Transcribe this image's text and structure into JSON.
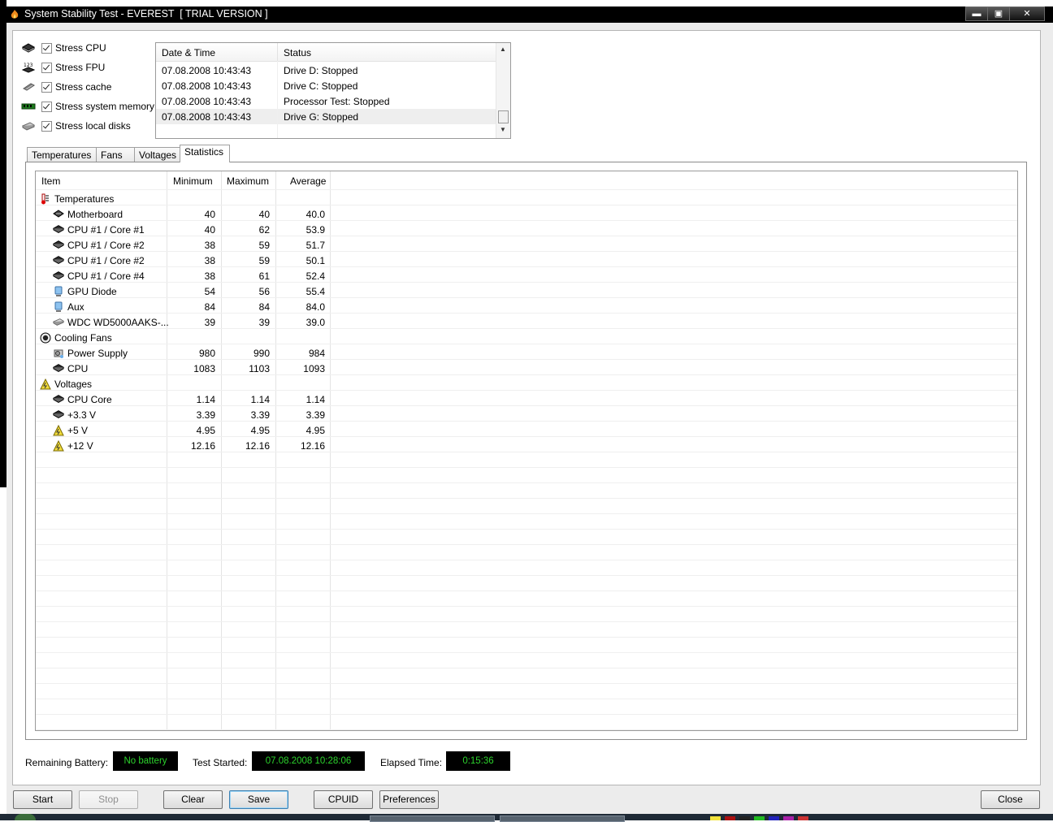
{
  "window": {
    "title": "System Stability Test - EVEREST  [ TRIAL VERSION ]",
    "buttons": {
      "minimize": "▬",
      "maximize": "▣",
      "close": "✕"
    }
  },
  "stress_options": [
    {
      "label": "Stress CPU",
      "icon": "cpu-icon",
      "checked": true
    },
    {
      "label": "Stress FPU",
      "icon": "fpu-icon",
      "checked": true
    },
    {
      "label": "Stress cache",
      "icon": "cache-icon",
      "checked": true
    },
    {
      "label": "Stress system memory",
      "icon": "memory-icon",
      "checked": true
    },
    {
      "label": "Stress local disks",
      "icon": "disk-icon",
      "checked": true
    }
  ],
  "log": {
    "headers": {
      "datetime": "Date & Time",
      "status": "Status"
    },
    "rows": [
      {
        "datetime": "07.08.2008 10:43:43",
        "status": "Drive D: Stopped"
      },
      {
        "datetime": "07.08.2008 10:43:43",
        "status": "Drive C: Stopped"
      },
      {
        "datetime": "07.08.2008 10:43:43",
        "status": "Processor Test: Stopped"
      },
      {
        "datetime": "07.08.2008 10:43:43",
        "status": "Drive G: Stopped"
      }
    ]
  },
  "tabs": [
    {
      "label": "Temperatures",
      "active": false
    },
    {
      "label": "Fans",
      "active": false
    },
    {
      "label": "Voltages",
      "active": false
    },
    {
      "label": "Statistics",
      "active": true
    }
  ],
  "stats": {
    "headers": {
      "item": "Item",
      "min": "Minimum",
      "max": "Maximum",
      "avg": "Average"
    },
    "rows": [
      {
        "type": "group",
        "name": "Temperatures",
        "icon": "thermometer-icon"
      },
      {
        "type": "item",
        "name": "Motherboard",
        "icon": "motherboard-icon",
        "min": "40",
        "max": "40",
        "avg": "40.0"
      },
      {
        "type": "item",
        "name": "CPU #1 / Core #1",
        "icon": "cpu-chip-icon",
        "min": "40",
        "max": "62",
        "avg": "53.9"
      },
      {
        "type": "item",
        "name": "CPU #1 / Core #2",
        "icon": "cpu-chip-icon",
        "min": "38",
        "max": "59",
        "avg": "51.7"
      },
      {
        "type": "item",
        "name": "CPU #1 / Core #2",
        "icon": "cpu-chip-icon",
        "min": "38",
        "max": "59",
        "avg": "50.1"
      },
      {
        "type": "item",
        "name": "CPU #1 / Core #4",
        "icon": "cpu-chip-icon",
        "min": "38",
        "max": "61",
        "avg": "52.4"
      },
      {
        "type": "item",
        "name": "GPU Diode",
        "icon": "monitor-icon",
        "min": "54",
        "max": "56",
        "avg": "55.4"
      },
      {
        "type": "item",
        "name": "Aux",
        "icon": "monitor-icon",
        "min": "84",
        "max": "84",
        "avg": "84.0"
      },
      {
        "type": "item",
        "name": "WDC WD5000AAKS-...",
        "icon": "hard-disk-icon",
        "min": "39",
        "max": "39",
        "avg": "39.0"
      },
      {
        "type": "group",
        "name": "Cooling Fans",
        "icon": "fan-icon"
      },
      {
        "type": "item",
        "name": "Power Supply",
        "icon": "power-supply-icon",
        "min": "980",
        "max": "990",
        "avg": "984"
      },
      {
        "type": "item",
        "name": "CPU",
        "icon": "cpu-chip-icon",
        "min": "1083",
        "max": "1103",
        "avg": "1093"
      },
      {
        "type": "group",
        "name": "Voltages",
        "icon": "voltage-icon"
      },
      {
        "type": "item",
        "name": "CPU Core",
        "icon": "cpu-chip-icon",
        "min": "1.14",
        "max": "1.14",
        "avg": "1.14"
      },
      {
        "type": "item",
        "name": "+3.3 V",
        "icon": "cpu-chip-icon",
        "min": "3.39",
        "max": "3.39",
        "avg": "3.39"
      },
      {
        "type": "item",
        "name": "+5 V",
        "icon": "voltage-icon",
        "min": "4.95",
        "max": "4.95",
        "avg": "4.95"
      },
      {
        "type": "item",
        "name": "+12 V",
        "icon": "voltage-icon",
        "min": "12.16",
        "max": "12.16",
        "avg": "12.16"
      }
    ]
  },
  "status": {
    "battery_label": "Remaining Battery:",
    "battery_value": "No battery",
    "started_label": "Test Started:",
    "started_value": "07.08.2008 10:28:06",
    "elapsed_label": "Elapsed Time:",
    "elapsed_value": "0:15:36"
  },
  "buttons": {
    "start": "Start",
    "stop": "Stop",
    "clear": "Clear",
    "save": "Save",
    "cpuid": "CPUID",
    "preferences": "Preferences",
    "close": "Close"
  },
  "colors": {
    "status_text": "#2cd32c",
    "status_bg": "#000000"
  }
}
